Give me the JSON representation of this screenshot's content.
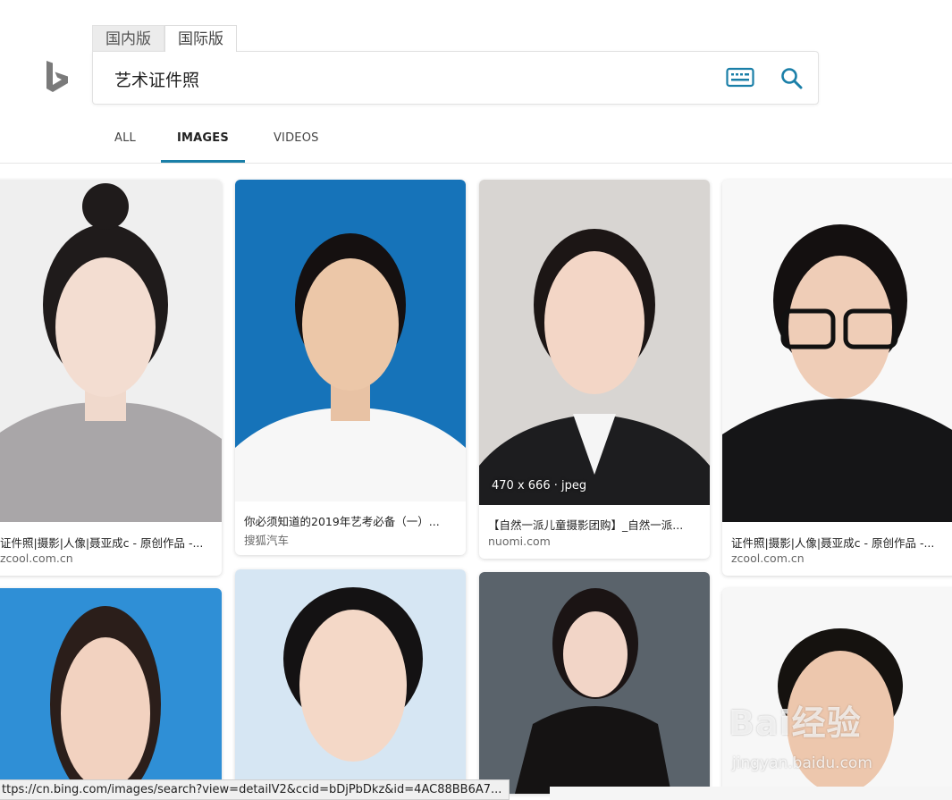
{
  "header": {
    "region_tabs": [
      {
        "label": "国内版",
        "active": false
      },
      {
        "label": "国际版",
        "active": true
      }
    ],
    "search": {
      "value": "艺术证件照",
      "placeholder": ""
    },
    "icons": {
      "logo": "bing-logo-icon",
      "keyboard": "keyboard-icon",
      "search": "search-icon"
    }
  },
  "scope_tabs": [
    {
      "label": "ALL",
      "active": false
    },
    {
      "label": "IMAGES",
      "active": true
    },
    {
      "label": "VIDEOS",
      "active": false
    }
  ],
  "results": [
    {
      "caption": "证件照|摄影|人像|聂亚成c - 原创作品 -...",
      "source": "zcool.com.cn",
      "bg": "#f2f2f2"
    },
    {
      "caption": "你必须知道的2019年艺考必备（一）...",
      "source": "搜狐汽车",
      "bg": "#1673b9"
    },
    {
      "caption": "【自然一派儿童摄影团购】_自然一派...",
      "source": "nuomi.com",
      "bg": "#d9d6d3",
      "dims": "470 x 666 · jpeg"
    },
    {
      "caption": "证件照|摄影|人像|聂亚成c - 原创作品 -...",
      "source": "zcool.com.cn",
      "bg": "#f7f7f7"
    },
    {
      "caption": "",
      "source": "",
      "bg": "#2f8fd6"
    },
    {
      "caption": "",
      "source": "",
      "bg": "#d6e6f3"
    },
    {
      "caption": "",
      "source": "",
      "bg": "#5a636b"
    },
    {
      "caption": "",
      "source": "",
      "bg": "#f7f7f7"
    }
  ],
  "watermark": {
    "logo": "Bai经验",
    "url": "jingyan.baidu.com"
  },
  "status_bar": {
    "url": "ttps://cn.bing.com/images/search?view=detailV2&ccid=bDjPbDkz&id=4AC88BB6A7..."
  },
  "colors": {
    "accent": "#1a7fa8",
    "bing_logo": "#7a7a7a"
  }
}
